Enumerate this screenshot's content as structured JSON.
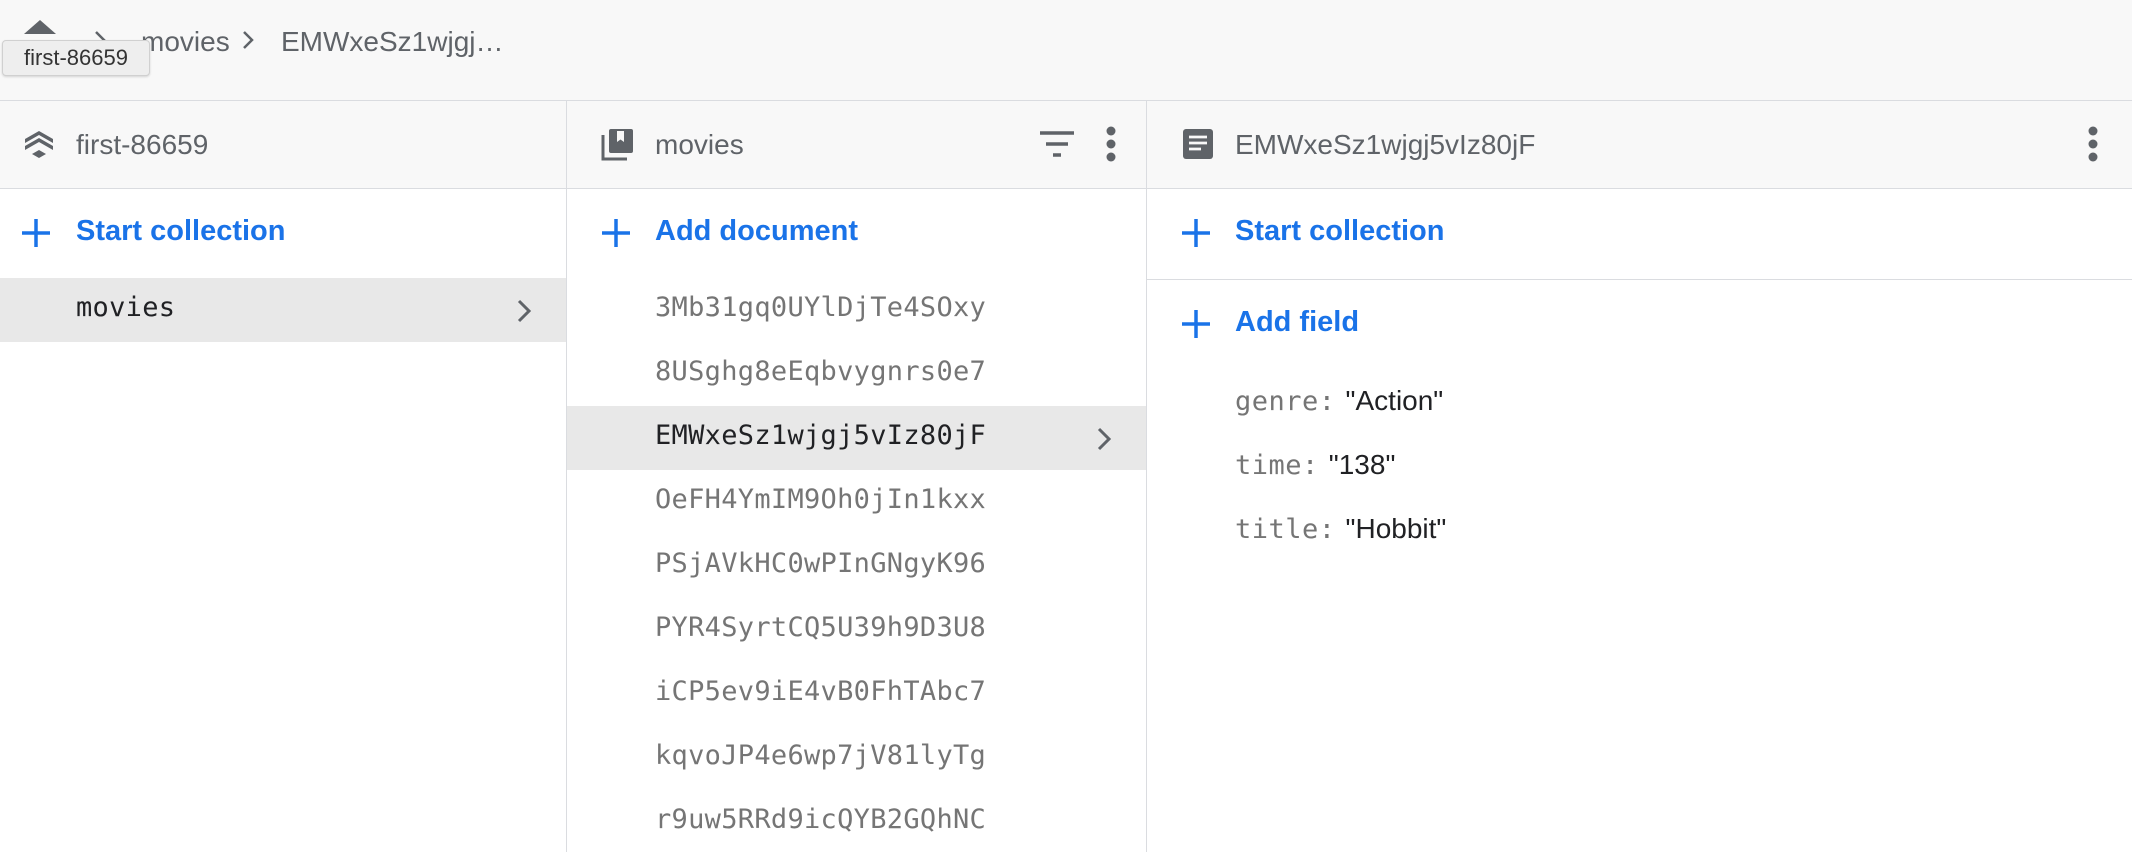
{
  "breadcrumb": {
    "items": [
      "movies",
      "EMWxeSz1wjgj…"
    ],
    "tooltip": "first-86659"
  },
  "project_column": {
    "title": "first-86659",
    "action_label": "Start collection",
    "items": [
      {
        "label": "movies",
        "selected": true
      }
    ]
  },
  "collection_column": {
    "title": "movies",
    "action_label": "Add document",
    "items": [
      {
        "label": "3Mb31gq0UYlDjTe4SOxy",
        "selected": false
      },
      {
        "label": "8USghg8eEqbvygnrs0e7",
        "selected": false
      },
      {
        "label": "EMWxeSz1wjgj5vIz80jF",
        "selected": true
      },
      {
        "label": "OeFH4YmIM9Oh0jIn1kxx",
        "selected": false
      },
      {
        "label": "PSjAVkHC0wPInGNgyK96",
        "selected": false
      },
      {
        "label": "PYR4SyrtCQ5U39h9D3U8",
        "selected": false
      },
      {
        "label": "iCP5ev9iE4vB0FhTAbc7",
        "selected": false
      },
      {
        "label": "kqvoJP4e6wp7jV81lyTg",
        "selected": false
      },
      {
        "label": "r9uw5RRd9icQYB2GQhNC",
        "selected": false
      }
    ]
  },
  "document_column": {
    "title": "EMWxeSz1wjgj5vIz80jF",
    "collection_action_label": "Start collection",
    "field_action_label": "Add field",
    "fields": [
      {
        "key": "genre:",
        "value": "\"Action\""
      },
      {
        "key": "time:",
        "value": "\"138\""
      },
      {
        "key": "title:",
        "value": "\"Hobbit\""
      }
    ]
  },
  "icons": {
    "home": "home-icon",
    "chevron": "chevron-right-icon",
    "project": "firestore-stack-icon",
    "collection": "collection-icon",
    "document": "document-icon",
    "filter": "filter-icon",
    "more": "more-vert-icon",
    "add": "plus-icon"
  },
  "colors": {
    "accent": "#1a73e8",
    "header_bg": "#f8f8f8",
    "selected_bg": "#e8e8e8",
    "icon_gray": "#5f6368"
  }
}
